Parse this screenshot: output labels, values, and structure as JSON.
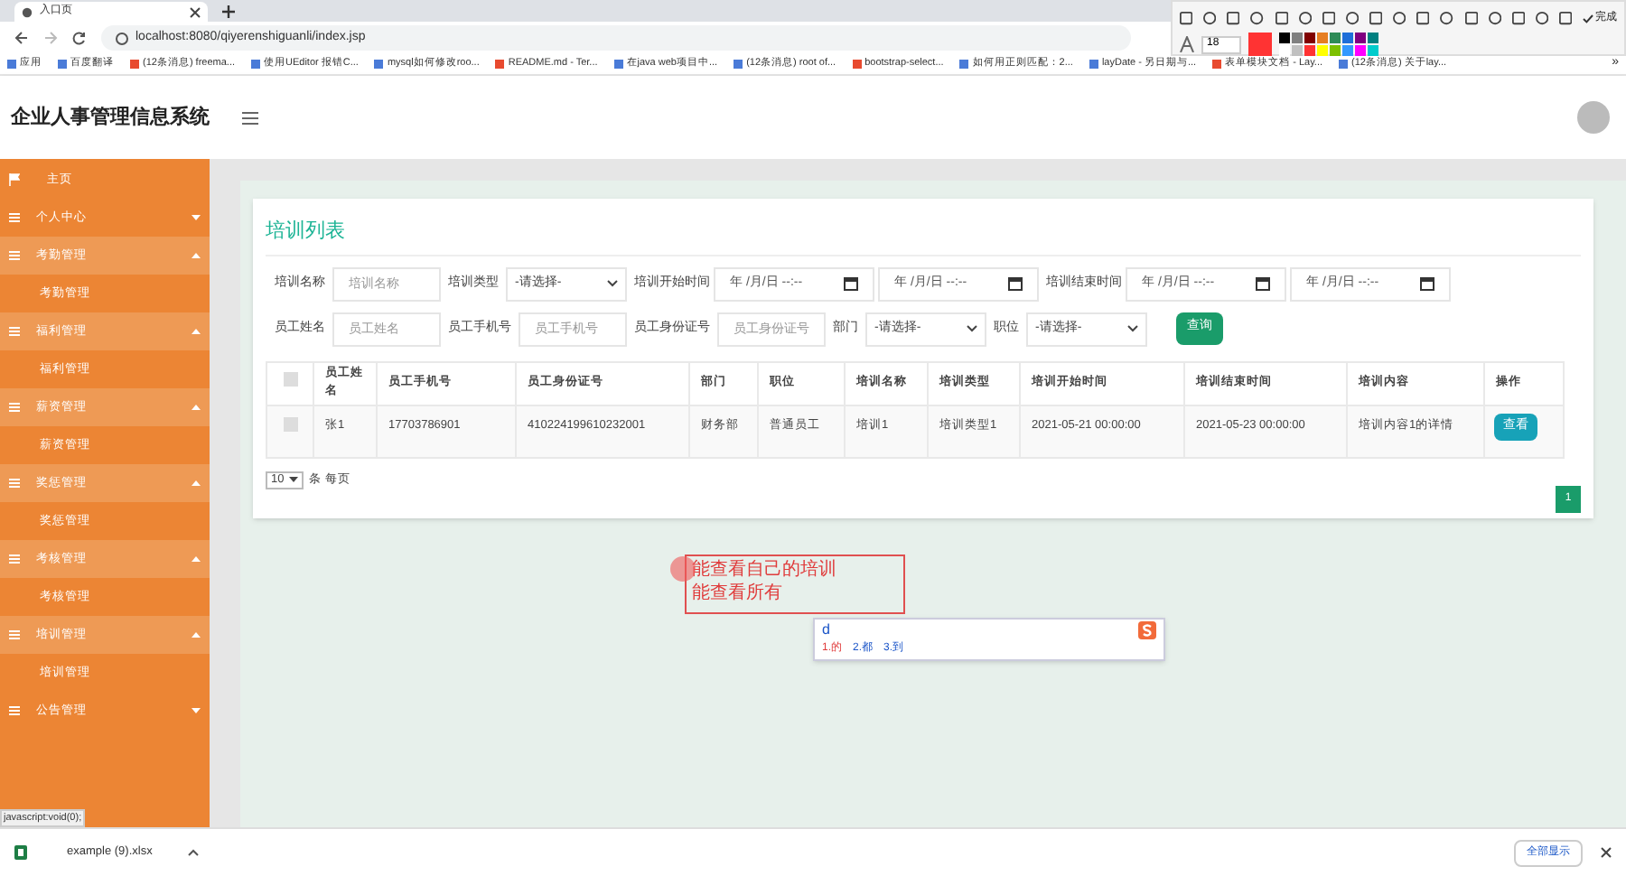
{
  "browser": {
    "tab_title": "入口页",
    "address": "localhost:8080/qiyerenshiguanli/index.jsp",
    "bookmarks": [
      "应用",
      "百度翻译",
      "(12条消息) freema...",
      "使用UEditor 报错C...",
      "mysql如何修改roo...",
      "README.md - Ter...",
      "在java web项目中...",
      "(12条消息) root of...",
      "bootstrap-select...",
      "如何用正则匹配：2...",
      "layDate - 另日期与...",
      "表单模块文档 - Lay...",
      "(12条消息) 关于lay..."
    ],
    "more_bookmarks": "»"
  },
  "capture_toolbar": {
    "done": "完成",
    "font_size": "18"
  },
  "app": {
    "title": "企业人事管理信息系统"
  },
  "sidebar": {
    "items": [
      {
        "kind": "home",
        "label": "主页",
        "expanded": false
      },
      {
        "kind": "group",
        "label": "个人中心",
        "expanded": false
      },
      {
        "kind": "group",
        "label": "考勤管理",
        "expanded": true,
        "children": [
          {
            "label": "考勤管理"
          }
        ]
      },
      {
        "kind": "group",
        "label": "福利管理",
        "expanded": true,
        "children": [
          {
            "label": "福利管理"
          }
        ]
      },
      {
        "kind": "group",
        "label": "薪资管理",
        "expanded": true,
        "children": [
          {
            "label": "薪资管理"
          }
        ]
      },
      {
        "kind": "group",
        "label": "奖惩管理",
        "expanded": true,
        "children": [
          {
            "label": "奖惩管理"
          }
        ]
      },
      {
        "kind": "group",
        "label": "考核管理",
        "expanded": true,
        "children": [
          {
            "label": "考核管理"
          }
        ]
      },
      {
        "kind": "group",
        "label": "培训管理",
        "expanded": true,
        "children": [
          {
            "label": "培训管理"
          }
        ]
      },
      {
        "kind": "group",
        "label": "公告管理",
        "expanded": false
      }
    ]
  },
  "panel": {
    "title": "培训列表",
    "filters": [
      {
        "kind": "text",
        "label": "培训名称",
        "placeholder": "培训名称"
      },
      {
        "kind": "select",
        "label": "培训类型",
        "value": "-请选择-"
      },
      {
        "kind": "daterange",
        "label": "培训开始时间",
        "from": "年 /月/日 --:--",
        "to": "年 /月/日 --:--"
      },
      {
        "kind": "daterange",
        "label": "培训结束时间",
        "from": "年 /月/日 --:--",
        "to": "年 /月/日 --:--"
      },
      {
        "kind": "text",
        "label": "员工姓名",
        "placeholder": "员工姓名"
      },
      {
        "kind": "text",
        "label": "员工手机号",
        "placeholder": "员工手机号"
      },
      {
        "kind": "text",
        "label": "员工身份证号",
        "placeholder": "员工身份证号"
      },
      {
        "kind": "select",
        "label": "部门",
        "value": "-请选择-"
      },
      {
        "kind": "select",
        "label": "职位",
        "value": "-请选择-"
      }
    ],
    "search_button": "查询",
    "table": {
      "columns": [
        "员工姓名",
        "员工手机号",
        "员工身份证号",
        "部门",
        "职位",
        "培训名称",
        "培训类型",
        "培训开始时间",
        "培训结束时间",
        "培训内容",
        "操作"
      ],
      "all_checked": false,
      "rows": [
        {
          "checked": false,
          "cells": [
            "张1",
            "17703786901",
            "410224199610232001",
            "财务部",
            "普通员工",
            "培训1",
            "培训类型1",
            "2021-05-21 00:00:00",
            "2021-05-23 00:00:00",
            "培训内容1的详情"
          ],
          "action": "查看"
        }
      ]
    },
    "page_size": "10",
    "page_size_suffix": "条 每页",
    "pages": [
      {
        "label": "1",
        "selected": true
      }
    ]
  },
  "annotation": {
    "lines": [
      "能查看自己的培训",
      "能查看所有"
    ],
    "ime_input": "d",
    "ime_candidates": [
      "1.的",
      "2.都",
      "3.到"
    ]
  },
  "status_link": "javascript:void(0);",
  "downloads": {
    "file": "example (9).xlsx",
    "show_all": "全部显示"
  }
}
